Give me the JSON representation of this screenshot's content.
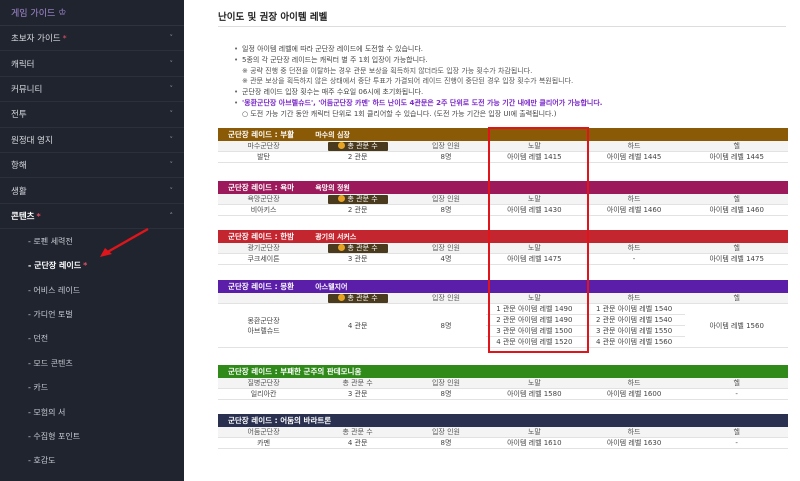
{
  "sidebar": {
    "header": "게임 가이드",
    "crown_icon": "crown-icon",
    "items": [
      {
        "label": "초보자 가이드",
        "star": true,
        "chev": "˅"
      },
      {
        "label": "캐릭터",
        "star": false,
        "chev": "˅"
      },
      {
        "label": "커뮤니티",
        "star": false,
        "chev": "˅"
      },
      {
        "label": "전투",
        "star": false,
        "chev": "˅"
      },
      {
        "label": "원정대 영지",
        "star": false,
        "chev": "˅"
      },
      {
        "label": "항해",
        "star": false,
        "chev": "˅"
      },
      {
        "label": "생활",
        "star": false,
        "chev": "˅"
      },
      {
        "label": "콘텐츠",
        "star": true,
        "chev": "˄",
        "active": true
      }
    ],
    "subitems": [
      {
        "label": "- 로펜 세력전"
      },
      {
        "label": "- 군단장 레이드",
        "star": true,
        "active": true
      },
      {
        "label": "- 어비스 레이드"
      },
      {
        "label": "- 가디언 토벌"
      },
      {
        "label": "- 던전"
      },
      {
        "label": "- 모드 콘텐츠"
      },
      {
        "label": "- 카드"
      },
      {
        "label": "- 모험의 서"
      },
      {
        "label": "- 수집형 포인트"
      },
      {
        "label": "- 호감도"
      }
    ]
  },
  "page": {
    "title": "난이도 및 권장 아이템 레벨",
    "notes": [
      {
        "kind": "bullet",
        "text": "일정 아이템 레벨에 따라 군단장 레이드에 도전할 수 있습니다."
      },
      {
        "kind": "bullet",
        "text": "5종의 각 군단장 레이드는 캐릭터 별 주 1회 입장이 가능합니다."
      },
      {
        "kind": "sub",
        "text": "※ 공략 진행 중 던전을 이탈하는 경우 관문 보상을 획득하지 않더라도 입장 가능 횟수가 차감됩니다."
      },
      {
        "kind": "sub",
        "text": "※ 관문 보상을 획득하지 않은 상태에서 중단 투표가 가결되어 레이드 진행이 중단된 경우 입장 횟수가 복원됩니다."
      },
      {
        "kind": "bullet",
        "text": "군단장 레이드 입장 횟수는 매주 수요일 06시에 초기화됩니다."
      },
      {
        "kind": "hl",
        "text": "'몽환군단장 아브렐슈드', '어둠군단장 카멘' 하드 난이도 4관문은 2주 단위로 도전 가능 기간 내에만 클리어가 가능합니다."
      },
      {
        "kind": "circ",
        "text": "○ 도전 가능 기간 동안 캐릭터 단위로 1회 클리어할 수 있습니다. (도전 가능 기간은 입장 UI에 출력됩니다.)"
      }
    ]
  },
  "highlight_labels": {
    "r1": "마수의 심장",
    "r2": "욕망의 정원",
    "r3": "광기의 서커스",
    "r4": "아스텔지어"
  },
  "raids": [
    {
      "title": "군단장 레이드 : 부활",
      "color": "#8a5a06",
      "headers": [
        "마수군단장",
        "",
        "입장 인원",
        "노말",
        "하드",
        "헬"
      ],
      "badge": "총 관문 수",
      "rows": [
        [
          "발탄",
          "2 관문",
          "8명",
          "아이템 레벨 1415",
          "아이템 레벨 1445",
          "아이템 레벨 1445"
        ]
      ]
    },
    {
      "title": "군단장 레이드 : 욕마",
      "color": "#9c1a5c",
      "headers": [
        "욕망군단장",
        "",
        "입장 인원",
        "노말",
        "하드",
        "헬"
      ],
      "badge": "총 관문 수",
      "rows": [
        [
          "비아키스",
          "2 관문",
          "8명",
          "아이템 레벨 1430",
          "아이템 레벨 1460",
          "아이템 레벨 1460"
        ]
      ]
    },
    {
      "title": "군단장 레이드 : 한밤",
      "color": "#c4262f",
      "headers": [
        "광기군단장",
        "",
        "입장 인원",
        "노말",
        "하드",
        "헬"
      ],
      "badge": "총 관문 수",
      "rows": [
        [
          "쿠크세이튼",
          "3 관문",
          "4명",
          "아이템 레벨 1475",
          "-",
          "아이템 레벨 1475"
        ]
      ]
    },
    {
      "title": "군단장 레이드 : 몽환",
      "color": "#5b1ea8",
      "headers": [
        "",
        "",
        "입장 인원",
        "노말",
        "하드",
        "헬"
      ],
      "badge": "총 관문 수",
      "name_lines": [
        "몽환군단장",
        "아브렐슈드"
      ],
      "gates": "4 관문",
      "people": "8명",
      "normal": [
        "1 관문 아이템 레벨 1490",
        "2 관문 아이템 레벨 1490",
        "3 관문 아이템 레벨 1500",
        "4 관문 아이템 레벨 1520"
      ],
      "hard": [
        "1 관문 아이템 레벨 1540",
        "2 관문 아이템 레벨 1540",
        "3 관문 아이템 레벨 1550",
        "4 관문 아이템 레벨 1560"
      ],
      "hell": "아이템 레벨 1560"
    },
    {
      "title": "군단장 레이드 : 부패한 군주의 판데모니움",
      "color": "#2f8a1a",
      "headers": [
        "질병군단장",
        "총 관문 수",
        "입장 인원",
        "노말",
        "하드",
        "헬"
      ],
      "rows": [
        [
          "일리아칸",
          "3 관문",
          "8명",
          "아이템 레벨 1580",
          "아이템 레벨 1600",
          "-"
        ]
      ]
    },
    {
      "title": "군단장 레이드 : 어둠의 바라트론",
      "color": "#2a3050",
      "headers": [
        "어둠군단장",
        "총 관문 수",
        "입장 인원",
        "노말",
        "하드",
        "헬"
      ],
      "rows": [
        [
          "카멘",
          "4 관문",
          "8명",
          "아이템 레벨 1610",
          "아이템 레벨 1630",
          "-"
        ]
      ]
    }
  ]
}
